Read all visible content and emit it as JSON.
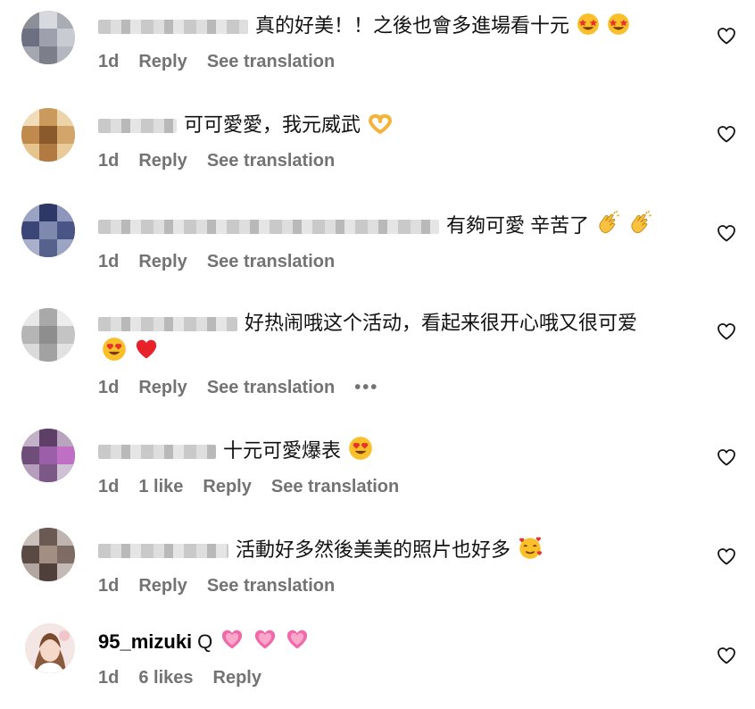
{
  "comments": [
    {
      "text": "真的好美！！之後也會多進場看十元",
      "emoji": [
        "star-struck",
        "star-struck"
      ],
      "meta": {
        "age": "1d",
        "reply": "Reply",
        "translate": "See translation"
      }
    },
    {
      "text": "可可愛愛，我元威武",
      "emoji": [
        "heart-hands"
      ],
      "meta": {
        "age": "1d",
        "reply": "Reply",
        "translate": "See translation"
      }
    },
    {
      "text": "有夠可愛 辛苦了",
      "emoji": [
        "clapping-hands",
        "clapping-hands"
      ],
      "meta": {
        "age": "1d",
        "reply": "Reply",
        "translate": "See translation"
      }
    },
    {
      "text": "好热闹哦这个活动，看起来很开心哦又很可爱",
      "emoji": [
        "heart-eyes",
        "red-heart"
      ],
      "meta": {
        "age": "1d",
        "reply": "Reply",
        "translate": "See translation",
        "more": "•••"
      }
    },
    {
      "text": "十元可愛爆表",
      "emoji": [
        "heart-eyes"
      ],
      "meta": {
        "age": "1d",
        "likes": "1 like",
        "reply": "Reply",
        "translate": "See translation"
      }
    },
    {
      "text": "活動好多然後美美的照片也好多",
      "emoji": [
        "smiling-face-with-hearts"
      ],
      "meta": {
        "age": "1d",
        "reply": "Reply",
        "translate": "See translation"
      }
    },
    {
      "username": "95_mizuki",
      "text": "Q",
      "emoji": [
        "growing-heart",
        "growing-heart",
        "growing-heart"
      ],
      "meta": {
        "age": "1d",
        "likes": "6 likes",
        "reply": "Reply"
      }
    }
  ],
  "colors": {
    "meta": "#737373",
    "text": "#111111",
    "background": "#ffffff"
  },
  "icons": {
    "like": "heart-outline-icon"
  }
}
